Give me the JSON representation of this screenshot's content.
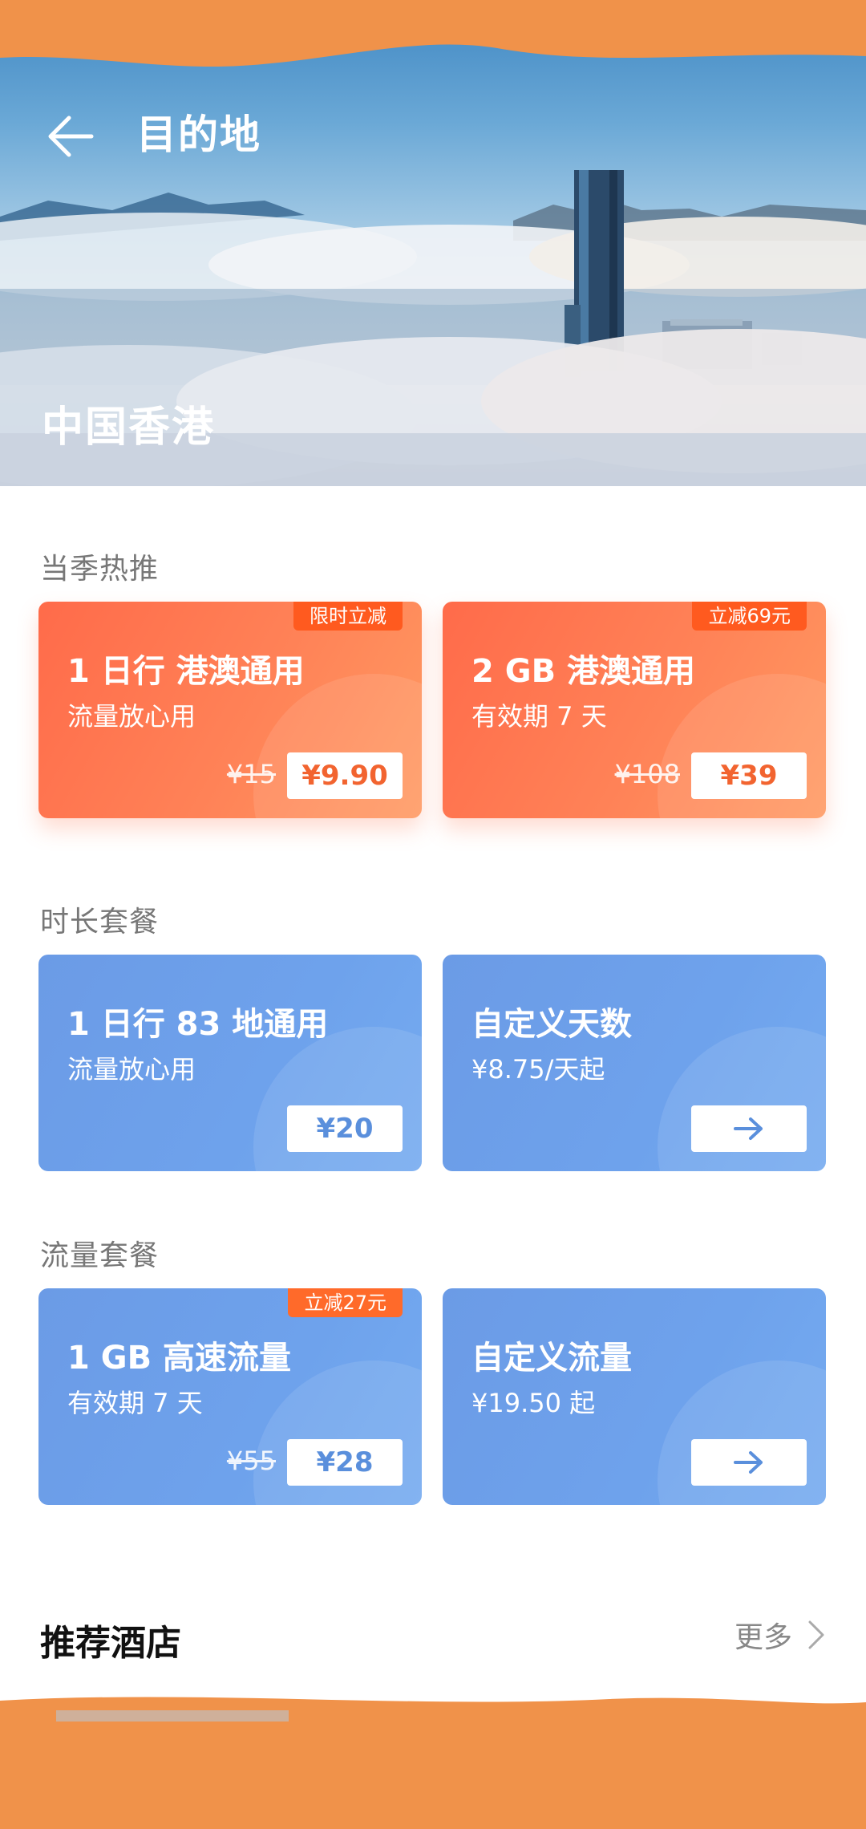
{
  "header": {
    "title": "目的地",
    "destination": "中国香港"
  },
  "sections": {
    "seasonal": {
      "title": "当季热推",
      "cards": [
        {
          "title": "1 日行  港澳通用",
          "subtitle": "流量放心用",
          "badge": "限时立减",
          "old_price": "¥15",
          "price": "¥9.90"
        },
        {
          "title": "2 GB 港澳通用",
          "subtitle": "有效期 7 天",
          "badge": "立减69元",
          "old_price": "¥108",
          "price": "¥39"
        }
      ]
    },
    "duration": {
      "title": "时长套餐",
      "cards": [
        {
          "title": "1 日行  83 地通用",
          "subtitle": "流量放心用",
          "price": "¥20"
        },
        {
          "title": "自定义天数",
          "subtitle": "¥8.75/天起"
        }
      ]
    },
    "data": {
      "title": "流量套餐",
      "cards": [
        {
          "title": "1 GB 高速流量",
          "subtitle": "有效期 7 天",
          "badge": "立减27元",
          "old_price": "¥55",
          "price": "¥28"
        },
        {
          "title": "自定义流量",
          "subtitle": "¥19.50 起"
        }
      ]
    }
  },
  "hotels": {
    "title": "推荐酒店",
    "more_label": "更多"
  },
  "icons": {
    "back": "arrow-left-icon",
    "arrow": "arrow-right-icon",
    "chevron": "chevron-right-icon"
  },
  "colors": {
    "orange_card": "#ff7650",
    "blue_card": "#6ea2ec",
    "badge": "#ff5a1f",
    "redaction": "#f0924a"
  }
}
